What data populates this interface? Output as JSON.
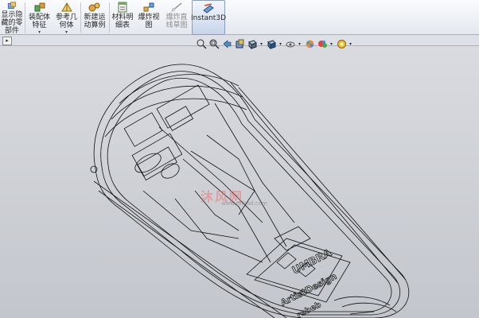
{
  "ribbon": {
    "buttons": [
      {
        "label": "显示隐\n藏的零\n部件",
        "icon": "show-hide-components-icon"
      },
      {
        "label": "装配体\n特征",
        "icon": "assembly-features-icon",
        "dropdown": "▾"
      },
      {
        "label": "参考几\n何体",
        "icon": "reference-geometry-icon",
        "dropdown": "▾"
      },
      {
        "label": "新建运\n动算例",
        "icon": "new-motion-study-icon"
      },
      {
        "label": "材料明\n细表",
        "icon": "bill-of-materials-icon"
      },
      {
        "label": "爆炸视\n图",
        "icon": "exploded-view-icon"
      },
      {
        "label": "爆炸直\n线草图",
        "icon": "explode-line-sketch-icon"
      },
      {
        "label": "Instant3D",
        "icon": "instant3d-icon"
      }
    ]
  },
  "tab_arrow": "▸",
  "view_toolbar": {
    "icons": [
      "zoom-to-fit-icon",
      "zoom-to-area-icon",
      "previous-view-icon",
      "section-view-icon",
      "view-orientation-icon",
      "display-style-icon",
      "hide-show-items-icon",
      "edit-appearance-icon",
      "apply-scene-icon",
      "view-settings-icon"
    ],
    "dropdown": "▾"
  },
  "model_text": {
    "brand": "UMBRA",
    "line2": "ArtistDesign",
    "line3": "rebeb"
  },
  "watermark": {
    "main": "沐风网",
    "sub": "www.mfcad.com"
  },
  "colors": {
    "ribbon_bg": "#eef1f6",
    "viewport_bg": "#c9ccd3",
    "wireframe": "#111111",
    "active_button": "#c8d4ea"
  }
}
